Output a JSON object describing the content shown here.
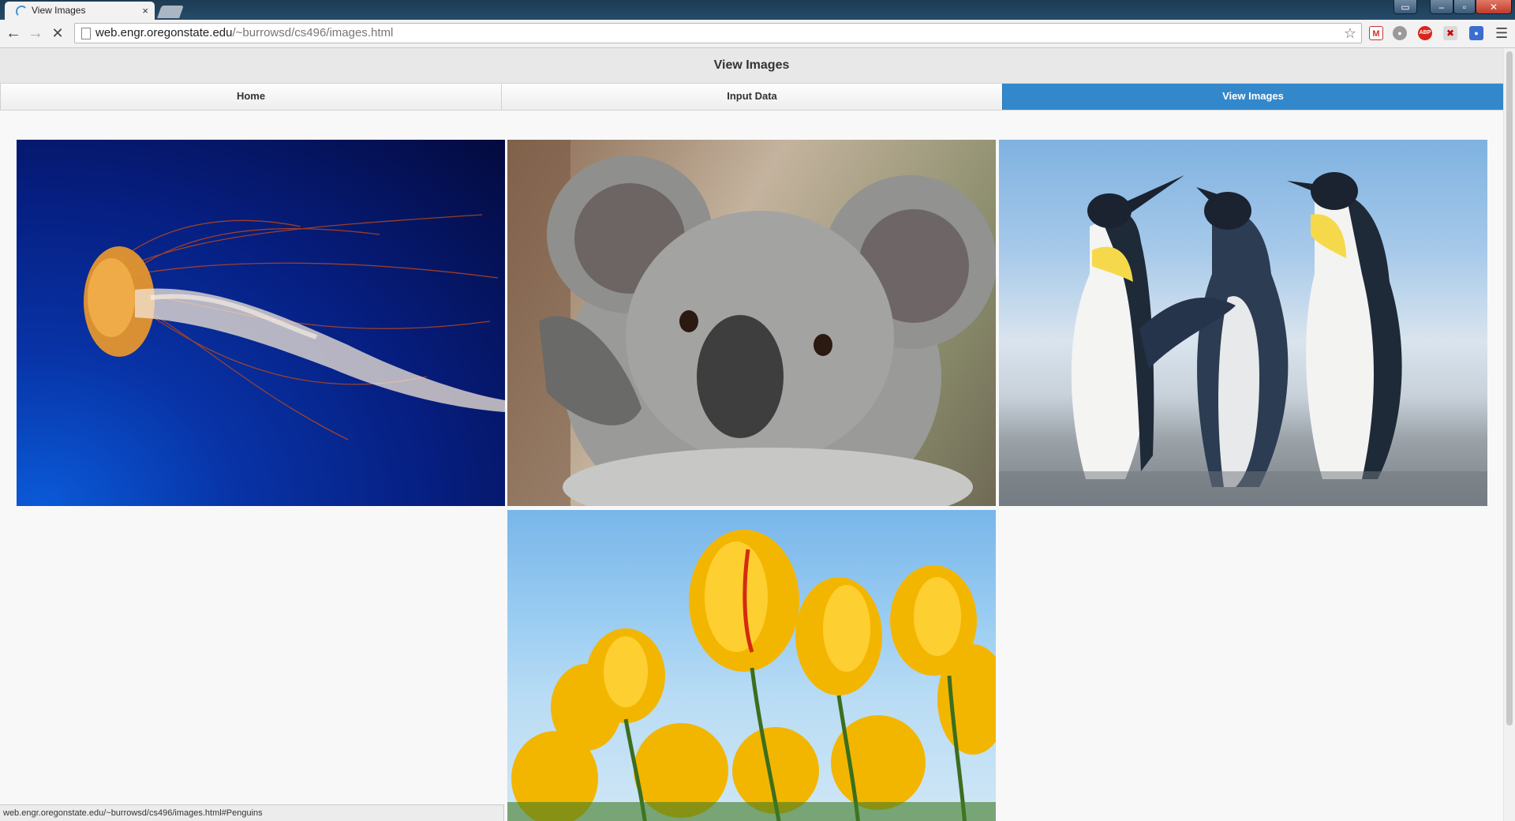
{
  "browser": {
    "tab_title": "View Images",
    "tab_close": "×",
    "url_host": "web.engr.oregonstate.edu",
    "url_path": "/~burrowsd/cs496/images.html",
    "status_url": "web.engr.oregonstate.edu/~burrowsd/cs496/images.html#Penguins",
    "extensions": [
      "gmail-icon",
      "chat-icon",
      "adblock-plus-icon",
      "red-extension-icon",
      "blue-extension-icon"
    ],
    "abp_label": "ABP"
  },
  "page": {
    "header_title": "View Images",
    "nav": [
      {
        "label": "Home",
        "active": false
      },
      {
        "label": "Input Data",
        "active": false
      },
      {
        "label": "View Images",
        "active": true
      }
    ],
    "accent_color": "#3388cc",
    "images": [
      "jellyfish",
      "koala",
      "penguins",
      "tulips"
    ]
  }
}
